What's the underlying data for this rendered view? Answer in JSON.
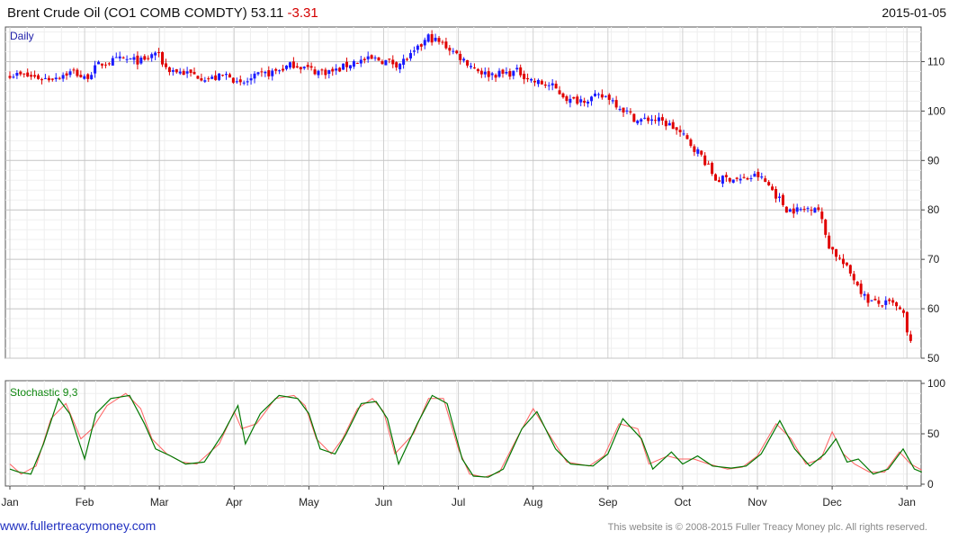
{
  "header": {
    "instrument": "Brent Crude Oil",
    "ticker": "(CO1 COMB COMDTY)",
    "last": "53.11",
    "change": "-3.31",
    "date": "2015-01-05"
  },
  "footer": {
    "site": "www.fullertreacymoney.com",
    "copyright": "This website is © 2008-2015 Fuller Treacy Money plc. All rights reserved."
  },
  "colors": {
    "up": "#1a1aff",
    "down": "#e00000",
    "k_line": "#007700",
    "d_line": "#ff6060",
    "grid": "#d8d8d8"
  },
  "chart_data": [
    {
      "type": "candlestick",
      "panel_label": "Daily",
      "ylim": [
        50,
        117
      ],
      "yticks": [
        50,
        60,
        70,
        80,
        90,
        100,
        110
      ],
      "x_categories": [
        "Jan",
        "Feb",
        "Mar",
        "Apr",
        "May",
        "Jun",
        "Jul",
        "Aug",
        "Sep",
        "Oct",
        "Nov",
        "Dec",
        "Jan"
      ],
      "grid": true,
      "close_path": [
        [
          0,
          107.5
        ],
        [
          0.25,
          107
        ],
        [
          0.5,
          106.5
        ],
        [
          0.85,
          108
        ],
        [
          1.0,
          106.5
        ],
        [
          1.2,
          109.5
        ],
        [
          1.5,
          110.5
        ],
        [
          1.8,
          110
        ],
        [
          1.95,
          112
        ],
        [
          2.1,
          108.5
        ],
        [
          2.4,
          107.5
        ],
        [
          2.7,
          106.5
        ],
        [
          2.95,
          107.5
        ],
        [
          3.05,
          105
        ],
        [
          3.3,
          107
        ],
        [
          3.55,
          108
        ],
        [
          3.8,
          109.5
        ],
        [
          4.1,
          108
        ],
        [
          4.35,
          108
        ],
        [
          4.6,
          110
        ],
        [
          4.9,
          110.5
        ],
        [
          5.2,
          109.5
        ],
        [
          5.4,
          111.5
        ],
        [
          5.6,
          115
        ],
        [
          5.85,
          113
        ],
        [
          6.1,
          110
        ],
        [
          6.35,
          107.5
        ],
        [
          6.6,
          107.5
        ],
        [
          6.8,
          108
        ],
        [
          7.0,
          106
        ],
        [
          7.25,
          105
        ],
        [
          7.5,
          102
        ],
        [
          7.7,
          102.5
        ],
        [
          8.0,
          103
        ],
        [
          8.15,
          101
        ],
        [
          8.4,
          98
        ],
        [
          8.6,
          98.5
        ],
        [
          8.85,
          97
        ],
        [
          9.0,
          95
        ],
        [
          9.25,
          91
        ],
        [
          9.45,
          86
        ],
        [
          9.65,
          86.5
        ],
        [
          9.8,
          86
        ],
        [
          10.0,
          87
        ],
        [
          10.15,
          85
        ],
        [
          10.4,
          80
        ],
        [
          10.6,
          80
        ],
        [
          10.8,
          81
        ],
        [
          10.95,
          73
        ],
        [
          11.1,
          70
        ],
        [
          11.3,
          66
        ],
        [
          11.45,
          62
        ],
        [
          11.6,
          61
        ],
        [
          11.8,
          61
        ],
        [
          11.95,
          59
        ],
        [
          12.0,
          55
        ],
        [
          12.05,
          53
        ]
      ]
    },
    {
      "type": "line",
      "panel_label": "Stochastic 9,3",
      "ylim": [
        0,
        100
      ],
      "yticks": [
        0,
        50,
        100
      ],
      "x_categories": [
        "Jan",
        "Feb",
        "Mar",
        "Apr",
        "May",
        "Jun",
        "Jul",
        "Aug",
        "Sep",
        "Oct",
        "Nov",
        "Dec",
        "Jan"
      ],
      "series": [
        {
          "role": "%K",
          "color": "#007700",
          "points": [
            [
              0,
              15
            ],
            [
              0.12,
              12
            ],
            [
              0.28,
              10
            ],
            [
              0.45,
              40
            ],
            [
              0.65,
              85
            ],
            [
              0.8,
              70
            ],
            [
              1.0,
              25
            ],
            [
              1.15,
              70
            ],
            [
              1.35,
              85
            ],
            [
              1.6,
              88
            ],
            [
              1.8,
              60
            ],
            [
              1.95,
              35
            ],
            [
              2.15,
              28
            ],
            [
              2.35,
              20
            ],
            [
              2.6,
              22
            ],
            [
              2.85,
              50
            ],
            [
              3.05,
              78
            ],
            [
              3.15,
              40
            ],
            [
              3.35,
              70
            ],
            [
              3.6,
              88
            ],
            [
              3.85,
              85
            ],
            [
              4.0,
              70
            ],
            [
              4.15,
              35
            ],
            [
              4.35,
              30
            ],
            [
              4.5,
              50
            ],
            [
              4.7,
              80
            ],
            [
              4.9,
              82
            ],
            [
              5.05,
              65
            ],
            [
              5.2,
              20
            ],
            [
              5.45,
              60
            ],
            [
              5.65,
              88
            ],
            [
              5.85,
              80
            ],
            [
              6.05,
              25
            ],
            [
              6.2,
              8
            ],
            [
              6.4,
              7
            ],
            [
              6.6,
              15
            ],
            [
              6.85,
              55
            ],
            [
              7.05,
              72
            ],
            [
              7.3,
              35
            ],
            [
              7.5,
              20
            ],
            [
              7.8,
              18
            ],
            [
              8.0,
              30
            ],
            [
              8.2,
              65
            ],
            [
              8.45,
              45
            ],
            [
              8.6,
              15
            ],
            [
              8.85,
              32
            ],
            [
              9.0,
              20
            ],
            [
              9.2,
              28
            ],
            [
              9.4,
              18
            ],
            [
              9.65,
              16
            ],
            [
              9.85,
              18
            ],
            [
              10.05,
              30
            ],
            [
              10.3,
              63
            ],
            [
              10.5,
              35
            ],
            [
              10.7,
              18
            ],
            [
              10.9,
              30
            ],
            [
              11.05,
              45
            ],
            [
              11.2,
              22
            ],
            [
              11.35,
              25
            ],
            [
              11.55,
              10
            ],
            [
              11.75,
              15
            ],
            [
              11.95,
              35
            ],
            [
              12.1,
              15
            ],
            [
              12.2,
              12
            ]
          ]
        },
        {
          "role": "%D",
          "color": "#ff6060",
          "points": [
            [
              0,
              20
            ],
            [
              0.15,
              10
            ],
            [
              0.35,
              18
            ],
            [
              0.55,
              65
            ],
            [
              0.75,
              80
            ],
            [
              0.95,
              45
            ],
            [
              1.1,
              55
            ],
            [
              1.3,
              78
            ],
            [
              1.55,
              90
            ],
            [
              1.75,
              75
            ],
            [
              1.9,
              45
            ],
            [
              2.1,
              30
            ],
            [
              2.3,
              22
            ],
            [
              2.5,
              20
            ],
            [
              2.8,
              40
            ],
            [
              3.0,
              72
            ],
            [
              3.1,
              55
            ],
            [
              3.3,
              60
            ],
            [
              3.55,
              85
            ],
            [
              3.8,
              88
            ],
            [
              3.95,
              78
            ],
            [
              4.1,
              45
            ],
            [
              4.3,
              30
            ],
            [
              4.45,
              45
            ],
            [
              4.65,
              75
            ],
            [
              4.85,
              85
            ],
            [
              5.0,
              72
            ],
            [
              5.15,
              30
            ],
            [
              5.4,
              50
            ],
            [
              5.6,
              85
            ],
            [
              5.8,
              85
            ],
            [
              6.0,
              35
            ],
            [
              6.15,
              10
            ],
            [
              6.35,
              7
            ],
            [
              6.55,
              12
            ],
            [
              6.8,
              48
            ],
            [
              7.0,
              75
            ],
            [
              7.25,
              45
            ],
            [
              7.45,
              22
            ],
            [
              7.75,
              18
            ],
            [
              7.95,
              28
            ],
            [
              8.15,
              60
            ],
            [
              8.4,
              55
            ],
            [
              8.55,
              20
            ],
            [
              8.8,
              28
            ],
            [
              8.95,
              25
            ],
            [
              9.15,
              25
            ],
            [
              9.35,
              20
            ],
            [
              9.6,
              15
            ],
            [
              9.8,
              17
            ],
            [
              10.0,
              28
            ],
            [
              10.25,
              60
            ],
            [
              10.45,
              45
            ],
            [
              10.65,
              20
            ],
            [
              10.85,
              25
            ],
            [
              11.0,
              52
            ],
            [
              11.15,
              30
            ],
            [
              11.3,
              20
            ],
            [
              11.5,
              12
            ],
            [
              11.7,
              12
            ],
            [
              11.9,
              32
            ],
            [
              12.05,
              20
            ],
            [
              12.2,
              14
            ]
          ]
        }
      ]
    }
  ]
}
